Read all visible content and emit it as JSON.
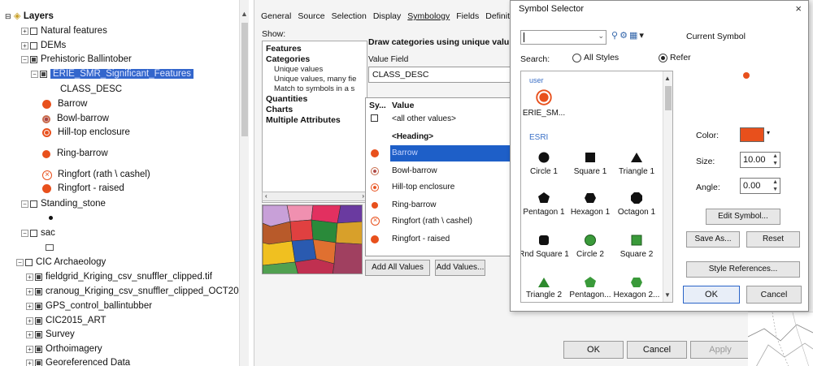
{
  "toc": {
    "title": "Layers",
    "items": [
      {
        "label": "Natural features"
      },
      {
        "label": "DEMs"
      },
      {
        "label": "Prehistoric Ballintober"
      },
      {
        "label": "ERIE_SMR_Significant_Features"
      },
      {
        "label": "CLASS_DESC"
      },
      {
        "label": "Barrow"
      },
      {
        "label": "Bowl-barrow"
      },
      {
        "label": "Hill-top enclosure"
      },
      {
        "label": "Ring-barrow"
      },
      {
        "label": "Ringfort (rath \\ cashel)"
      },
      {
        "label": "Ringfort - raised"
      },
      {
        "label": "Standing_stone"
      },
      {
        "label": "sac"
      },
      {
        "label": "CIC Archaeology"
      },
      {
        "label": "fieldgrid_Kriging_csv_snuffler_clipped.tif"
      },
      {
        "label": "cranoug_Kriging_csv_snuffler_clipped_OCT20"
      },
      {
        "label": "GPS_control_ballintubber"
      },
      {
        "label": "CIC2015_ART"
      },
      {
        "label": "Survey"
      },
      {
        "label": "Orthoimagery"
      },
      {
        "label": "Georeferenced Data"
      }
    ]
  },
  "props": {
    "tabs": [
      "General",
      "Source",
      "Selection",
      "Display",
      "Symbology",
      "Fields",
      "Definition"
    ],
    "show_label": "Show:",
    "show_items": [
      {
        "label": "Features",
        "style": "b"
      },
      {
        "label": "Categories",
        "style": "b"
      },
      {
        "label": "Unique values",
        "style": "sub"
      },
      {
        "label": "Unique values, many fie",
        "style": "sub"
      },
      {
        "label": "Match to symbols in a s",
        "style": "sub"
      },
      {
        "label": "Quantities",
        "style": "b"
      },
      {
        "label": "Charts",
        "style": "b"
      },
      {
        "label": "Multiple Attributes",
        "style": "b"
      }
    ],
    "draw_title": "Draw categories using unique valu",
    "value_field_label": "Value Field",
    "value_field": "CLASS_DESC",
    "grid_header_symbol": "Sy...",
    "grid_header_value": "Value",
    "rows": [
      {
        "value": "<all other values>"
      },
      {
        "value": "<Heading>"
      },
      {
        "value": "Barrow"
      },
      {
        "value": "Bowl-barrow"
      },
      {
        "value": "Hill-top enclosure"
      },
      {
        "value": "Ring-barrow"
      },
      {
        "value": "Ringfort (rath \\ cashel)"
      },
      {
        "value": "Ringfort - raised"
      }
    ],
    "add_all": "Add All Values",
    "add_values": "Add Values...",
    "ok": "OK",
    "cancel": "Cancel",
    "apply": "Apply"
  },
  "symbol_selector": {
    "title": "Symbol Selector",
    "close": "×",
    "current_symbol_label": "Current Symbol",
    "search_label": "Search:",
    "radio_all": "All Styles",
    "radio_refer": "Refer",
    "groups": {
      "user": "user",
      "esri": "ESRI"
    },
    "user_items": [
      {
        "label": "ERIE_SM..."
      }
    ],
    "esri_items": [
      {
        "label": "Circle 1",
        "icon": "circle-icon"
      },
      {
        "label": "Square 1",
        "icon": "square-icon"
      },
      {
        "label": "Triangle 1",
        "icon": "triangle-icon"
      },
      {
        "label": "Pentagon 1",
        "icon": "pentagon-icon"
      },
      {
        "label": "Hexagon 1",
        "icon": "hexagon-icon"
      },
      {
        "label": "Octagon 1",
        "icon": "octagon-icon"
      },
      {
        "label": "Rnd Square 1",
        "icon": "rounded-square-icon"
      },
      {
        "label": "Circle 2",
        "icon": "circle-icon"
      },
      {
        "label": "Square 2",
        "icon": "square-icon"
      },
      {
        "label": "Triangle 2",
        "icon": "triangle-icon"
      },
      {
        "label": "Pentagon...",
        "icon": "pentagon-icon"
      },
      {
        "label": "Hexagon 2...",
        "icon": "hexagon-icon"
      }
    ],
    "color_label": "Color:",
    "size_label": "Size:",
    "size_value": "10.00",
    "angle_label": "Angle:",
    "angle_value": "0.00",
    "edit_symbol": "Edit Symbol...",
    "save_as": "Save As...",
    "reset": "Reset",
    "style_references": "Style References...",
    "ok": "OK",
    "cancel": "Cancel"
  },
  "colors": {
    "accent_orange": "#e8501c",
    "selection_blue": "#1e5fc8",
    "green": "#3a9a3a"
  }
}
